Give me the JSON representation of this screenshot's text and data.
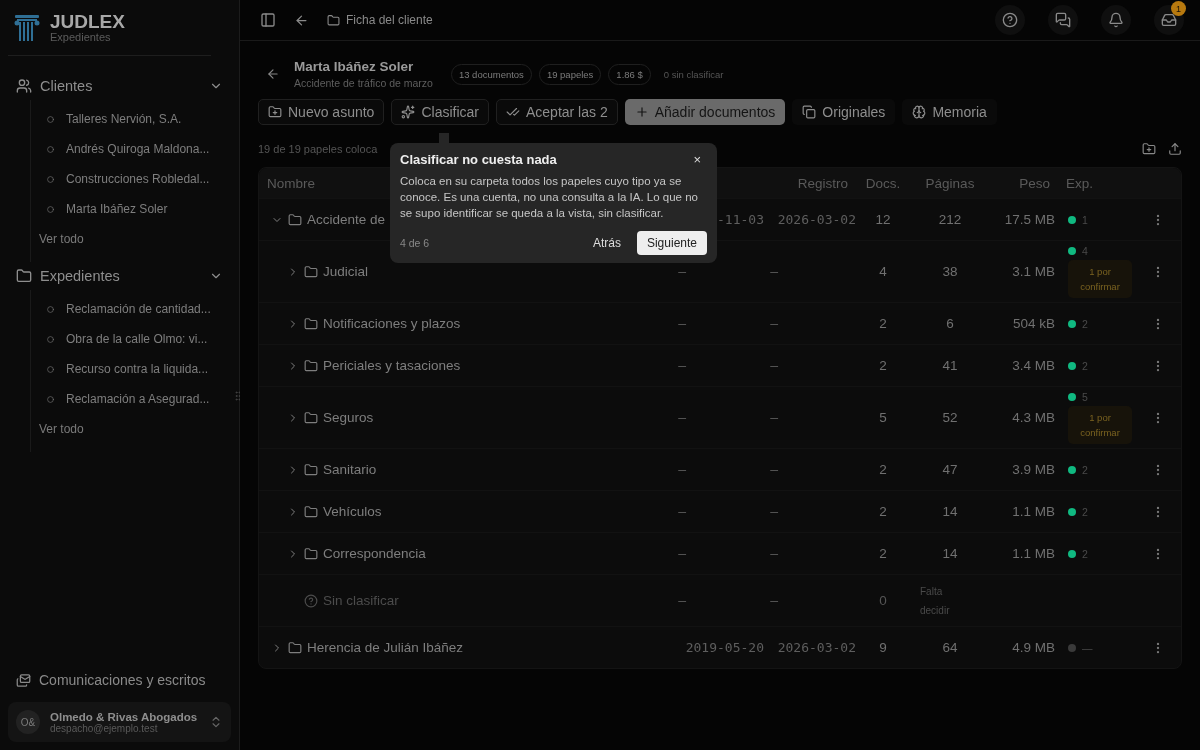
{
  "sidebar": {
    "brand": {
      "name": "JUDLEX",
      "subtitle": "Expedientes"
    },
    "sections": [
      {
        "label": "Clientes",
        "expanded": true,
        "items": [
          "Talleres Nervión, S.A.",
          "Andrés Quiroga Maldona...",
          "Construcciones Robledal...",
          "Marta Ibáñez Soler"
        ],
        "more": "Ver todo"
      },
      {
        "label": "Expedientes",
        "expanded": true,
        "items": [
          "Reclamación de cantidad...",
          "Obra de la calle Olmo: vi...",
          "Recurso contra la liquida...",
          "Reclamación a Asegurad..."
        ],
        "more": "Ver todo"
      }
    ],
    "footer_link": "Comunicaciones y escritos",
    "account": {
      "initials": "O&",
      "name": "Olmedo & Rivas Abogados",
      "email": "despacho@ejemplo.test"
    }
  },
  "topbar": {
    "breadcrumb": "Ficha del cliente",
    "badge": "1"
  },
  "header": {
    "title": "Marta Ibáñez Soler",
    "subtitle": "Accidente de tráfico de marzo",
    "stats": [
      "13 documentos",
      "19 papeles",
      "1.86 $"
    ],
    "note": "0 sin clasificar"
  },
  "toolbar": [
    {
      "label": "Nuevo asunto",
      "kind": "outline"
    },
    {
      "label": "Clasificar",
      "kind": "outline"
    },
    {
      "label": "Aceptar las 2",
      "kind": "outline"
    },
    {
      "label": "Añadir documentos",
      "kind": "primary"
    },
    {
      "label": "Originales",
      "kind": "ghost"
    },
    {
      "label": "Memoria",
      "kind": "ghost"
    }
  ],
  "status_text": "19 de 19 papeles coloca",
  "table": {
    "columns": [
      "Nombre",
      "Registro",
      "Docs.",
      "Páginas",
      "Peso",
      "Exp."
    ],
    "rows": [
      {
        "kind": "group",
        "name": "Accidente de",
        "expanded": true,
        "date": "-11-03",
        "registro": "2026-03-02",
        "docs": "12",
        "pages": "212",
        "size": "17.5 MB",
        "exp": {
          "color": "#10b981",
          "count": "1"
        },
        "children": [
          {
            "kind": "folder",
            "name": "Judicial",
            "date": "—",
            "registro": "—",
            "docs": "4",
            "pages": "38",
            "size": "3.1 MB",
            "exp": {
              "color": "#10b981",
              "count": "4",
              "pending": "1 por confirmar"
            }
          },
          {
            "kind": "folder",
            "name": "Notificaciones y plazos",
            "date": "—",
            "registro": "—",
            "docs": "2",
            "pages": "6",
            "size": "504 kB",
            "exp": {
              "color": "#10b981",
              "count": "2"
            }
          },
          {
            "kind": "folder",
            "name": "Periciales y tasaciones",
            "date": "—",
            "registro": "—",
            "docs": "2",
            "pages": "41",
            "size": "3.4 MB",
            "exp": {
              "color": "#10b981",
              "count": "2"
            }
          },
          {
            "kind": "folder",
            "name": "Seguros",
            "date": "—",
            "registro": "—",
            "docs": "5",
            "pages": "52",
            "size": "4.3 MB",
            "exp": {
              "color": "#10b981",
              "count": "5",
              "pending": "1 por confirmar"
            }
          },
          {
            "kind": "folder",
            "name": "Sanitario",
            "date": "—",
            "registro": "—",
            "docs": "2",
            "pages": "47",
            "size": "3.9 MB",
            "exp": {
              "color": "#10b981",
              "count": "2"
            }
          },
          {
            "kind": "folder",
            "name": "Vehículos",
            "date": "—",
            "registro": "—",
            "docs": "2",
            "pages": "14",
            "size": "1.1 MB",
            "exp": {
              "color": "#10b981",
              "count": "2"
            }
          },
          {
            "kind": "folder",
            "name": "Correspondencia",
            "date": "—",
            "registro": "—",
            "docs": "2",
            "pages": "14",
            "size": "1.1 MB",
            "exp": {
              "color": "#10b981",
              "count": "2"
            }
          },
          {
            "kind": "unclassified",
            "name": "Sin clasificar",
            "date": "—",
            "registro": "—",
            "docs": "0",
            "pages_note": "Falta decidir"
          }
        ]
      },
      {
        "kind": "group",
        "name": "Herencia de Julián Ibáñez",
        "expanded": false,
        "date": "2019-05-20",
        "registro": "2026-03-02",
        "docs": "9",
        "pages": "64",
        "size": "4.9 MB",
        "exp": {
          "color": "#3a3a3a",
          "count": "—"
        }
      }
    ]
  },
  "tour": {
    "title": "Clasificar no cuesta nada",
    "body": "Coloca en su carpeta todos los papeles cuyo tipo ya se conoce. Es una cuenta, no una consulta a la IA. Lo que no se supo identificar se queda a la vista, sin clasificar.",
    "step": "4 de 6",
    "back": "Atrás",
    "next": "Siguiente",
    "close": "×"
  }
}
